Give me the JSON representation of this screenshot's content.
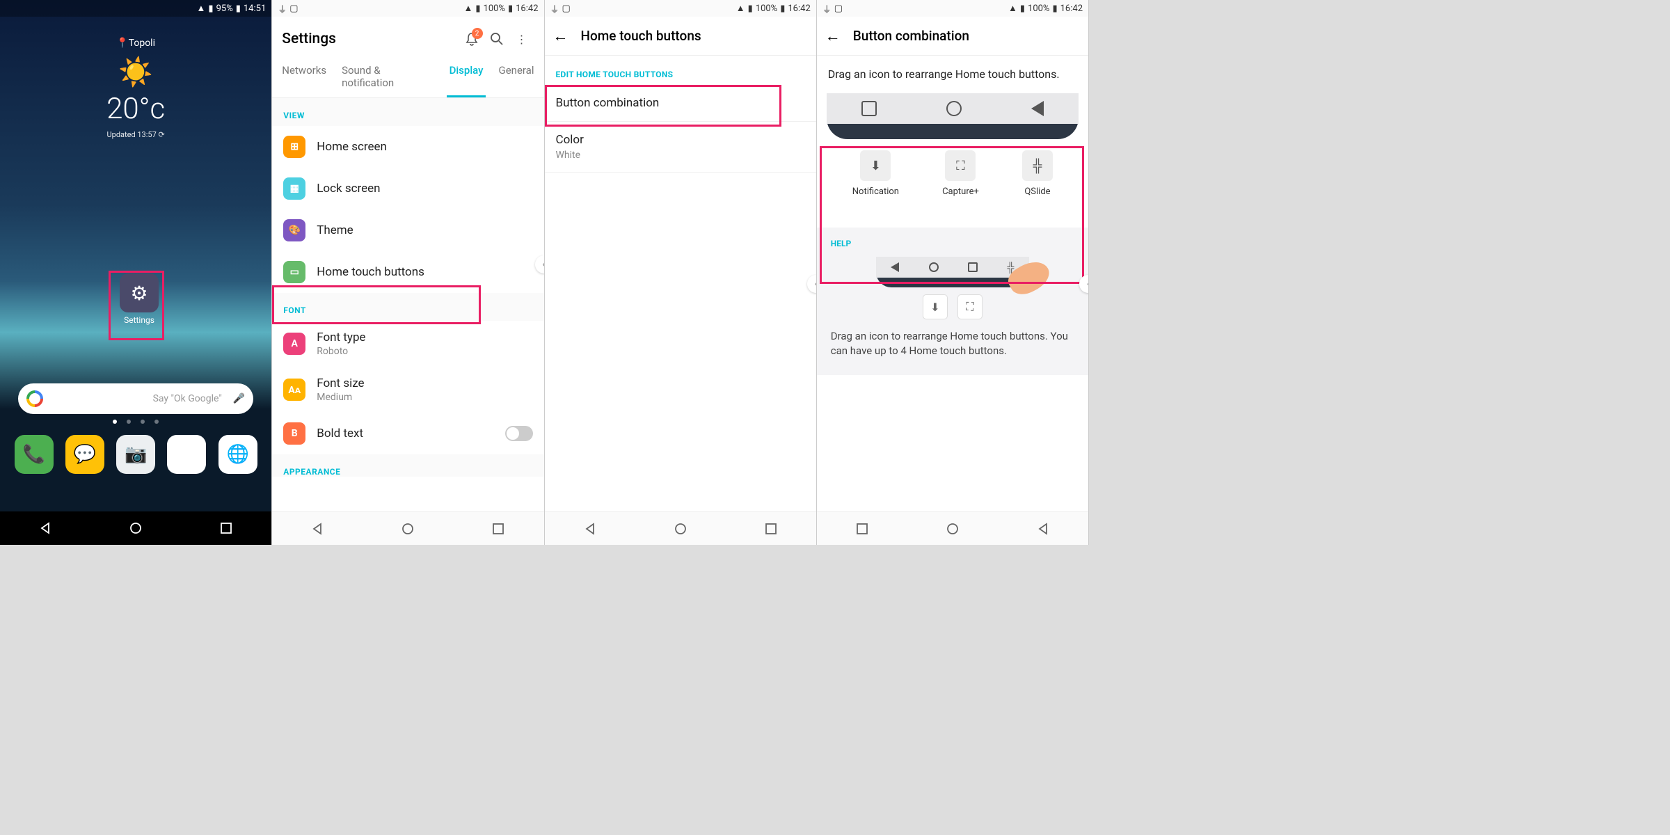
{
  "screen1": {
    "status": {
      "battery": "95%",
      "time": "14:51"
    },
    "location": "Topoli",
    "temp": "20°c",
    "updated": "Updated 13:57",
    "settings_label": "Settings",
    "search_placeholder": "Say \"Ok Google\""
  },
  "screen2": {
    "status": {
      "battery": "100%",
      "time": "16:42"
    },
    "title": "Settings",
    "badge": "2",
    "tabs": {
      "networks": "Networks",
      "sound": "Sound & notification",
      "display": "Display",
      "general": "General"
    },
    "sections": {
      "view": "VIEW",
      "font": "FONT",
      "appearance": "APPEARANCE"
    },
    "items": {
      "home_screen": "Home screen",
      "lock_screen": "Lock screen",
      "theme": "Theme",
      "home_touch": "Home touch buttons",
      "font_type": "Font type",
      "font_type_sub": "Roboto",
      "font_size": "Font size",
      "font_size_sub": "Medium",
      "bold_text": "Bold text"
    }
  },
  "screen3": {
    "status": {
      "battery": "100%",
      "time": "16:42"
    },
    "title": "Home touch buttons",
    "section": "EDIT HOME TOUCH BUTTONS",
    "items": {
      "combination": "Button combination",
      "color": "Color",
      "color_sub": "White"
    }
  },
  "screen4": {
    "status": {
      "battery": "100%",
      "time": "16:42"
    },
    "title": "Button combination",
    "instruction": "Drag an icon to rearrange Home touch buttons.",
    "extras": {
      "notification": "Notification",
      "capture": "Capture+",
      "qslide": "QSlide"
    },
    "help_title": "HELP",
    "help_text": "Drag an icon to rearrange Home touch buttons. You can have up to 4 Home touch buttons."
  }
}
